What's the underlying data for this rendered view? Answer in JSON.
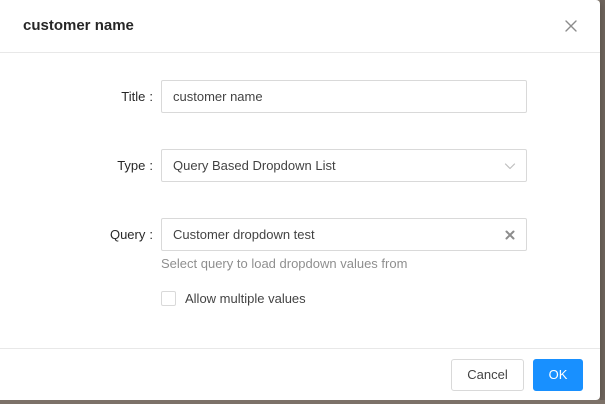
{
  "dialog": {
    "title": "customer name",
    "close_icon": "close-icon"
  },
  "form": {
    "title_field": {
      "label": "Title",
      "colon": ":",
      "value": "customer name"
    },
    "type_field": {
      "label": "Type",
      "colon": ":",
      "value": "Query Based Dropdown List",
      "icon": "chevron-down-icon"
    },
    "query_field": {
      "label": "Query",
      "colon": ":",
      "value": "Customer dropdown test",
      "icon": "clear-icon",
      "help": "Select query to load dropdown values from"
    },
    "multiple_values": {
      "label": "Allow multiple values",
      "checked": false
    }
  },
  "footer": {
    "cancel_label": "Cancel",
    "ok_label": "OK"
  },
  "colors": {
    "primary": "#1890ff",
    "border": "#d9d9d9",
    "divider": "#e8e8e8"
  }
}
